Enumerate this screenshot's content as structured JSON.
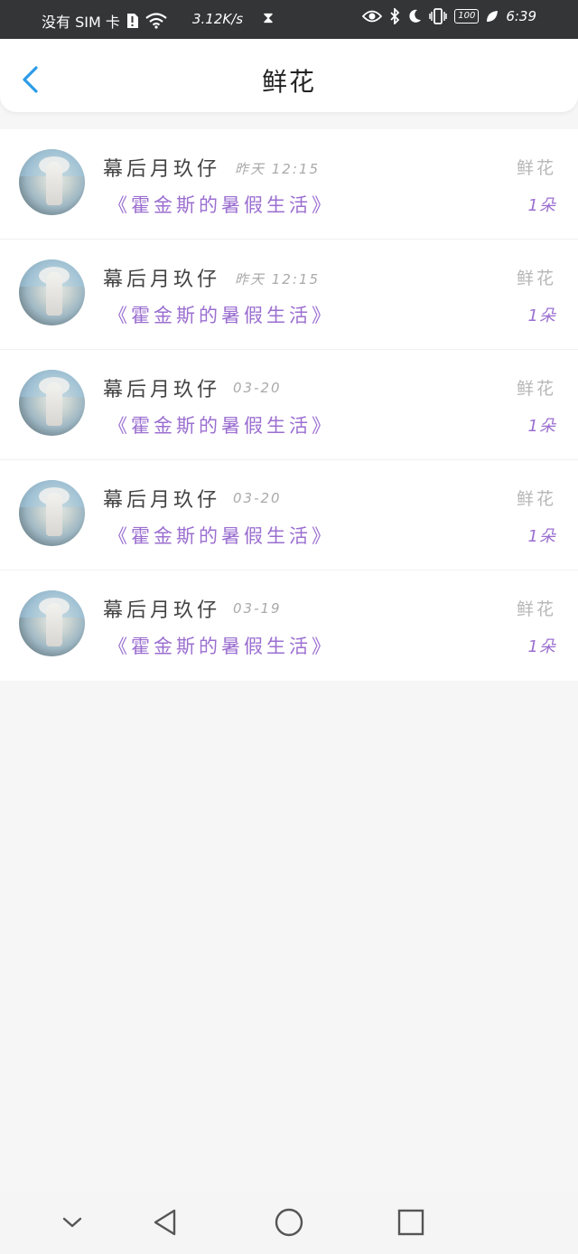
{
  "status_bar": {
    "carrier": "没有 SIM 卡",
    "speed": "3.12K/s",
    "battery": "100",
    "time": "6:39"
  },
  "header": {
    "title": "鲜花"
  },
  "items": [
    {
      "name": "幕后月玖仔",
      "time": "昨天 12:15",
      "book": "《霍金斯的暑假生活》",
      "gift": "鲜花",
      "count": "1朵"
    },
    {
      "name": "幕后月玖仔",
      "time": "昨天 12:15",
      "book": "《霍金斯的暑假生活》",
      "gift": "鲜花",
      "count": "1朵"
    },
    {
      "name": "幕后月玖仔",
      "time": "03-20",
      "book": "《霍金斯的暑假生活》",
      "gift": "鲜花",
      "count": "1朵"
    },
    {
      "name": "幕后月玖仔",
      "time": "03-20",
      "book": "《霍金斯的暑假生活》",
      "gift": "鲜花",
      "count": "1朵"
    },
    {
      "name": "幕后月玖仔",
      "time": "03-19",
      "book": "《霍金斯的暑假生活》",
      "gift": "鲜花",
      "count": "1朵"
    }
  ],
  "colors": {
    "accent": "#2b9be8",
    "purple": "#9b6fd0"
  },
  "icons": [
    "back-arrow-icon",
    "nav-collapse-icon",
    "nav-back-icon",
    "nav-home-icon",
    "nav-recents-icon"
  ]
}
